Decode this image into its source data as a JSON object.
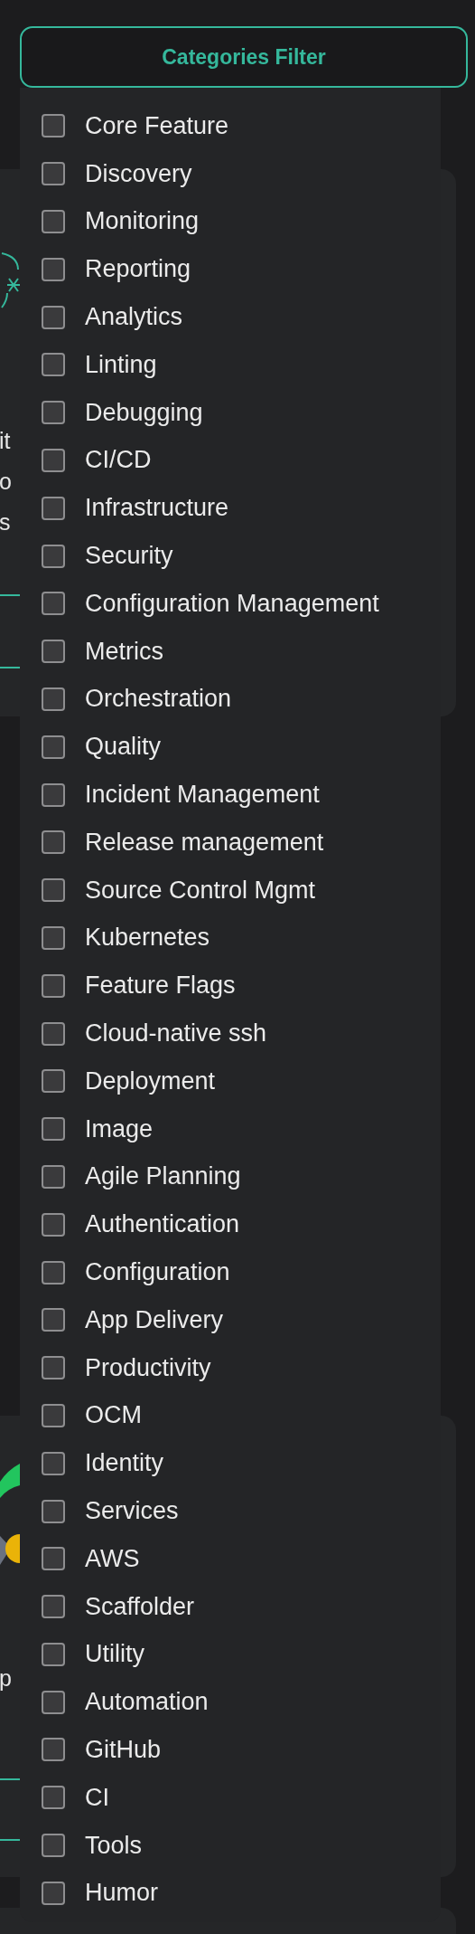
{
  "filter_button": {
    "label": "Categories Filter"
  },
  "background_cards": [
    {
      "kind": "text",
      "fragments": [
        "it",
        "o",
        "s"
      ]
    },
    {
      "kind": "chart",
      "fragments": [
        "p"
      ]
    },
    {
      "kind": "empty"
    }
  ],
  "categories": [
    {
      "label": "Core Feature",
      "checked": false
    },
    {
      "label": "Discovery",
      "checked": false
    },
    {
      "label": "Monitoring",
      "checked": false
    },
    {
      "label": "Reporting",
      "checked": false
    },
    {
      "label": "Analytics",
      "checked": false
    },
    {
      "label": "Linting",
      "checked": false
    },
    {
      "label": "Debugging",
      "checked": false
    },
    {
      "label": "CI/CD",
      "checked": false
    },
    {
      "label": "Infrastructure",
      "checked": false
    },
    {
      "label": "Security",
      "checked": false
    },
    {
      "label": "Configuration Management",
      "checked": false
    },
    {
      "label": "Metrics",
      "checked": false
    },
    {
      "label": "Orchestration",
      "checked": false
    },
    {
      "label": "Quality",
      "checked": false
    },
    {
      "label": "Incident Management",
      "checked": false
    },
    {
      "label": "Release management",
      "checked": false
    },
    {
      "label": "Source Control Mgmt",
      "checked": false
    },
    {
      "label": "Kubernetes",
      "checked": false
    },
    {
      "label": "Feature Flags",
      "checked": false
    },
    {
      "label": "Cloud-native ssh",
      "checked": false
    },
    {
      "label": "Deployment",
      "checked": false
    },
    {
      "label": "Image",
      "checked": false
    },
    {
      "label": "Agile Planning",
      "checked": false
    },
    {
      "label": "Authentication",
      "checked": false
    },
    {
      "label": "Configuration",
      "checked": false
    },
    {
      "label": "App Delivery",
      "checked": false
    },
    {
      "label": "Productivity",
      "checked": false
    },
    {
      "label": "OCM",
      "checked": false
    },
    {
      "label": "Identity",
      "checked": false
    },
    {
      "label": "Services",
      "checked": false
    },
    {
      "label": "AWS",
      "checked": false
    },
    {
      "label": "Scaffolder",
      "checked": false
    },
    {
      "label": "Utility",
      "checked": false
    },
    {
      "label": "Automation",
      "checked": false
    },
    {
      "label": "GitHub",
      "checked": false
    },
    {
      "label": "CI",
      "checked": false
    },
    {
      "label": "Tools",
      "checked": false
    },
    {
      "label": "Humor",
      "checked": false
    }
  ]
}
